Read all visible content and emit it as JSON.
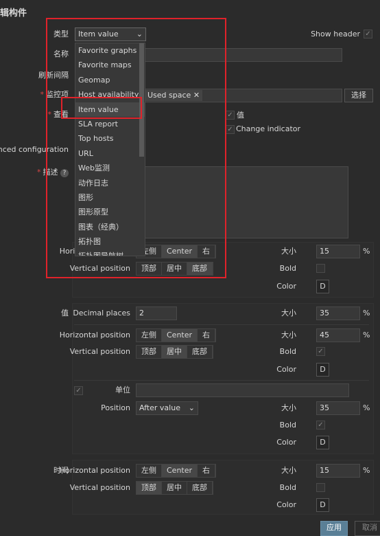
{
  "title": "辑构件",
  "form": {
    "type_label": "类型",
    "type_value": "Item value",
    "show_header_label": "Show header",
    "show_header_checked": true,
    "name_label": "名称",
    "name_value": "",
    "refresh_label": "刷新间隔",
    "item_label": "监控项",
    "item_tag": "Used space",
    "item_tag_remove": "✕",
    "select_button": "选择",
    "show_label": "查看",
    "show_options": [
      {
        "label": "值",
        "checked": true
      },
      {
        "label": "Change indicator",
        "checked": true
      }
    ],
    "advanced_label": "lvanced configuration",
    "description_label": "描述",
    "help_icon": "?",
    "required_mark": "*"
  },
  "dropdown": {
    "items": [
      "Favorite graphs",
      "Favorite maps",
      "Geomap",
      "Host availability",
      "Item value",
      "SLA report",
      "Top hosts",
      "URL",
      "Web监测",
      "动作日志",
      "图形",
      "图形原型",
      "图表（经典）",
      "拓扑图",
      "拓扑图导航树"
    ],
    "selected": "Item value"
  },
  "labels": {
    "horizontal": "Horizontal position",
    "vertical": "Vertical position",
    "size": "大小",
    "bold": "Bold",
    "color": "Color",
    "percent": "%",
    "decimal": "Decimal places",
    "units": "单位",
    "position": "Position",
    "color_value": "D"
  },
  "segments": {
    "horizontal": [
      "左侧",
      "Center",
      "右"
    ],
    "vertical": [
      "顶部",
      "居中",
      "底部"
    ]
  },
  "description_section": {
    "horizontal_active": "Center",
    "vertical_active": "底部",
    "size": "15",
    "bold": false
  },
  "value_section": {
    "label": "值",
    "decimal_places": "2",
    "decimal_size": "35",
    "horizontal_active": "Center",
    "vertical_active": "居中",
    "size": "45",
    "bold": true,
    "units_checked": true,
    "units_value": "",
    "position_value": "After value",
    "units_size": "35",
    "units_bold": true
  },
  "time_section": {
    "label": "时间",
    "horizontal_active": "Center",
    "vertical_active": "顶部",
    "size": "15",
    "bold": false
  },
  "footer": {
    "apply": "应用",
    "cancel": "取消"
  },
  "colors": {
    "background": "#2b2b2b",
    "annotation": "#e0222a",
    "apply": "#5a7f96"
  }
}
